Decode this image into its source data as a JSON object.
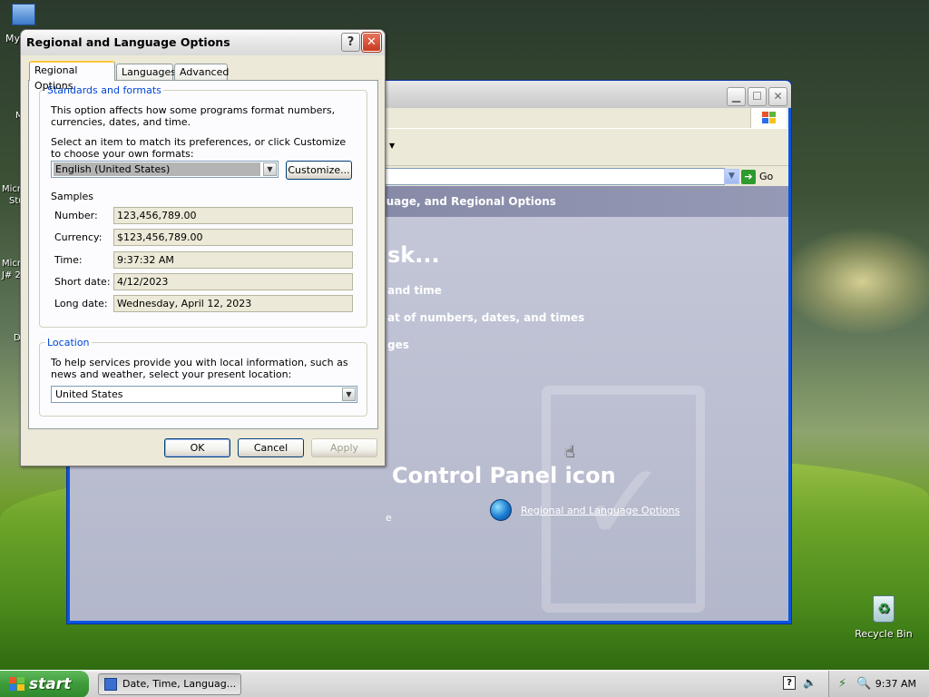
{
  "desktop": {
    "icons": [
      {
        "label": "My"
      },
      {
        "label": "Recycle Bin"
      }
    ],
    "partial_labels": [
      "M",
      "Micr",
      "Stu",
      "Micr",
      "J# 2",
      "D"
    ]
  },
  "control_panel": {
    "address_go": "Go",
    "header": "guage, and Regional Options",
    "task_title": "sk...",
    "tasks": [
      "and time",
      "at of numbers, dates, and times",
      "ges"
    ],
    "partial_text": "e",
    "icon_section_title": "Control Panel icon",
    "icon_link": "Regional and Language Options"
  },
  "dialog": {
    "title": "Regional and Language Options",
    "help_label": "?",
    "close_label": "✕",
    "tabs": [
      {
        "label": "Regional Options",
        "active": true
      },
      {
        "label": "Languages",
        "active": false
      },
      {
        "label": "Advanced",
        "active": false
      }
    ],
    "standards": {
      "legend": "Standards and formats",
      "description": "This option affects how some programs format numbers, currencies, dates, and time.",
      "instruction": "Select an item to match its preferences, or click Customize to choose your own formats:",
      "selected_format": "English (United States)",
      "customize_label": "Customize...",
      "samples_heading": "Samples",
      "samples": [
        {
          "label": "Number:",
          "value": "123,456,789.00"
        },
        {
          "label": "Currency:",
          "value": "$123,456,789.00"
        },
        {
          "label": "Time:",
          "value": "9:37:32 AM"
        },
        {
          "label": "Short date:",
          "value": "4/12/2023"
        },
        {
          "label": "Long date:",
          "value": "Wednesday, April 12, 2023"
        }
      ]
    },
    "location": {
      "legend": "Location",
      "description": "To help services provide you with local information, such as news and weather, select your present location:",
      "selected": "United States"
    },
    "buttons": {
      "ok": "OK",
      "cancel": "Cancel",
      "apply": "Apply"
    }
  },
  "taskbar": {
    "start_label": "start",
    "task_button": "Date, Time, Languag...",
    "tray_help": "?",
    "clock": "9:37 AM"
  }
}
